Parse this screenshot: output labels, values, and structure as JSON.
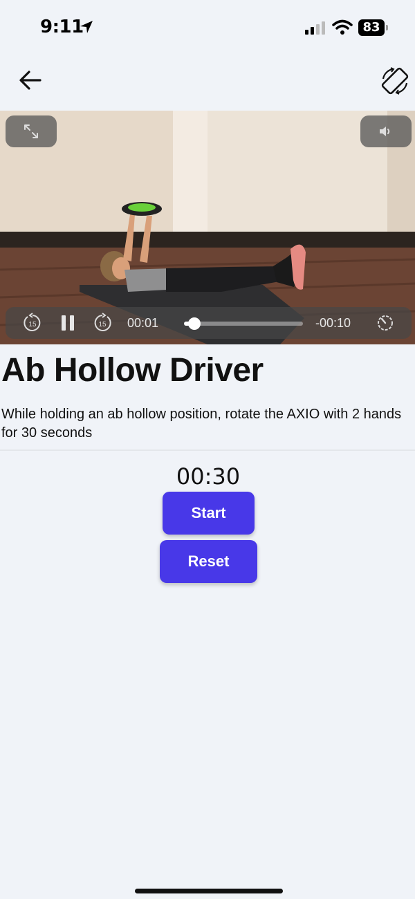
{
  "status_bar": {
    "time": "9:11",
    "battery": "83"
  },
  "nav": {
    "back_icon": "arrow-left-icon",
    "rotate_icon": "screen-rotation-icon"
  },
  "video": {
    "elapsed": "00:01",
    "remaining": "-00:10",
    "skip_back_label": "15",
    "skip_forward_label": "15",
    "progress": 0.09,
    "state": "playing",
    "icons": [
      "expand-icon",
      "volume-icon",
      "rewind-15-icon",
      "pause-icon",
      "forward-15-icon",
      "playback-speed-icon"
    ]
  },
  "exercise": {
    "title": "Ab Hollow Driver",
    "description": "While holding an ab hollow position, rotate the AXIO with 2 hands for 30 seconds"
  },
  "timer": {
    "display": "00:30",
    "start_label": "Start",
    "reset_label": "Reset"
  },
  "colors": {
    "accent": "#4838e8",
    "background": "#f0f3f8"
  }
}
